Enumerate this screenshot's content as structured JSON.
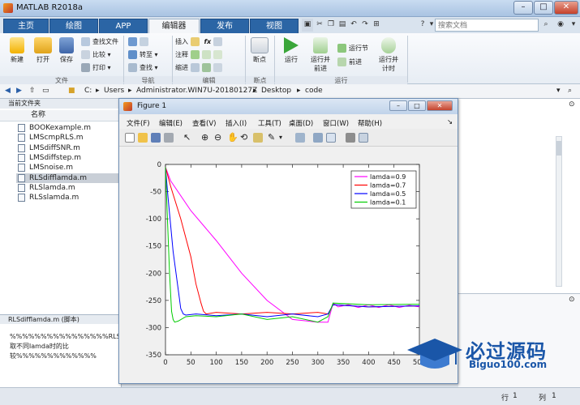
{
  "window": {
    "title": "MATLAB R2018a",
    "min": "–",
    "max": "□",
    "close": "✕"
  },
  "tabs": [
    "主页",
    "绘图",
    "APP",
    "编辑器",
    "发布",
    "视图"
  ],
  "search": {
    "placeholder": "搜索文档"
  },
  "ribbon": {
    "file": {
      "new": "新建",
      "open": "打开",
      "save": "保存",
      "find_files": "查找文件",
      "compare": "比较",
      "print": "打印",
      "group": "文件"
    },
    "nav": {
      "goto": "转至",
      "find": "查找",
      "group": "导航"
    },
    "edit": {
      "insert": "插入",
      "comment": "注释",
      "indent": "缩进",
      "fx": "fx",
      "group": "编辑"
    },
    "breakpoints": {
      "label": "断点",
      "group": "断点"
    },
    "run": {
      "run": "运行",
      "run_advance_1": "运行并",
      "run_advance_2": "前进",
      "run_section": "运行节",
      "advance": "前进",
      "run_time_1": "运行并",
      "run_time_2": "计时",
      "group": "运行"
    }
  },
  "path": [
    "C:",
    "Users",
    "Administrator.WIN7U-20180127Z",
    "Desktop",
    "code"
  ],
  "left_panel": {
    "title": "当前文件夹",
    "col_name": "名称",
    "files": [
      "BOOKexample.m",
      "LMScmpRLS.m",
      "LMSdiffSNR.m",
      "LMSdiffstep.m",
      "LMSnoise.m",
      "RLSdifflamda.m",
      "RLSlamda.m",
      "RLSslamda.m"
    ],
    "selected_index": 5
  },
  "details": {
    "title": "RLSdifflamda.m  (脚本)",
    "lines": [
      "%%%%%%%%%%%%%%%%RLS",
      "取不同lamda时的比",
      "较%%%%%%%%%%%%%"
    ]
  },
  "figure": {
    "title": "Figure 1",
    "menu": [
      "文件(F)",
      "编辑(E)",
      "查看(V)",
      "插入(I)",
      "工具(T)",
      "桌面(D)",
      "窗口(W)",
      "帮助(H)"
    ]
  },
  "status": {
    "line_label": "行",
    "line_value": "1",
    "col_label": "列",
    "col_value": "1"
  },
  "watermark": {
    "cn": "必过源码",
    "en": "Biguo100.com"
  },
  "chart_data": {
    "type": "line",
    "title": "",
    "xlabel": "",
    "ylabel": "",
    "xlim": [
      0,
      500
    ],
    "ylim": [
      -350,
      0
    ],
    "xticks": [
      0,
      50,
      100,
      150,
      200,
      250,
      300,
      350,
      400,
      450,
      500
    ],
    "yticks": [
      0,
      -50,
      -100,
      -150,
      -200,
      -250,
      -300,
      -350
    ],
    "grid": false,
    "legend_position": "top-right",
    "series": [
      {
        "name": "lamda=0.9",
        "color": "#ff00ff",
        "x": [
          0,
          10,
          50,
          100,
          150,
          200,
          250,
          300,
          320,
          330,
          340,
          360,
          380,
          400,
          420,
          440,
          460,
          480,
          500
        ],
        "y": [
          -5,
          -30,
          -85,
          -140,
          -200,
          -250,
          -285,
          -290,
          -290,
          -255,
          -262,
          -258,
          -263,
          -258,
          -263,
          -258,
          -263,
          -259,
          -262
        ]
      },
      {
        "name": "lamda=0.7",
        "color": "#ff0000",
        "x": [
          0,
          10,
          30,
          50,
          60,
          70,
          75,
          80,
          100,
          150,
          200,
          250,
          300,
          320,
          330,
          400,
          500
        ],
        "y": [
          -5,
          -40,
          -100,
          -170,
          -220,
          -255,
          -270,
          -275,
          -272,
          -275,
          -272,
          -275,
          -272,
          -275,
          -258,
          -262,
          -260
        ]
      },
      {
        "name": "lamda=0.5",
        "color": "#0000ff",
        "x": [
          0,
          5,
          15,
          25,
          30,
          35,
          40,
          60,
          100,
          150,
          200,
          250,
          300,
          320,
          330,
          400,
          500
        ],
        "y": [
          -5,
          -60,
          -160,
          -230,
          -265,
          -275,
          -277,
          -275,
          -278,
          -275,
          -280,
          -275,
          -280,
          -275,
          -258,
          -262,
          -260
        ]
      },
      {
        "name": "lamda=0.1",
        "color": "#00cc00",
        "x": [
          0,
          3,
          8,
          12,
          15,
          18,
          25,
          40,
          60,
          100,
          150,
          200,
          250,
          300,
          320,
          330,
          400,
          500
        ],
        "y": [
          -5,
          -80,
          -200,
          -270,
          -285,
          -290,
          -288,
          -280,
          -278,
          -280,
          -275,
          -285,
          -280,
          -290,
          -280,
          -255,
          -258,
          -257
        ]
      }
    ]
  }
}
